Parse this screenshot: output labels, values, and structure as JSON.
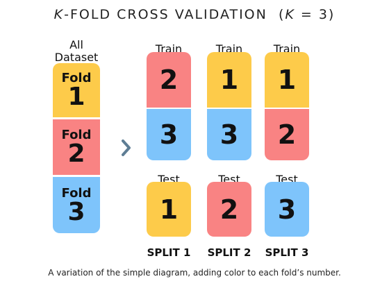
{
  "title": {
    "k_italic": "K",
    "main": "-FOLD CROSS VALIDATION",
    "paren": "(K = 3)"
  },
  "dataset": {
    "header_line1": "All",
    "header_line2": "Dataset",
    "folds": [
      {
        "word": "Fold",
        "number": "1",
        "color": "#FDCB4A"
      },
      {
        "word": "Fold",
        "number": "2",
        "color": "#F98383"
      },
      {
        "word": "Fold",
        "number": "3",
        "color": "#7EC4FB"
      }
    ]
  },
  "arrow_icon": "chevron-right",
  "splits": [
    {
      "label": "SPLIT 1",
      "train_header": "Train",
      "test_header": "Test",
      "train": [
        {
          "number": "2",
          "color": "#F98383"
        },
        {
          "number": "3",
          "color": "#7EC4FB"
        }
      ],
      "test": {
        "number": "1",
        "color": "#FDCB4A"
      }
    },
    {
      "label": "SPLIT 2",
      "train_header": "Train",
      "test_header": "Test",
      "train": [
        {
          "number": "1",
          "color": "#FDCB4A"
        },
        {
          "number": "3",
          "color": "#7EC4FB"
        }
      ],
      "test": {
        "number": "2",
        "color": "#F98383"
      }
    },
    {
      "label": "SPLIT 3",
      "train_header": "Train",
      "test_header": "Test",
      "train": [
        {
          "number": "1",
          "color": "#FDCB4A"
        },
        {
          "number": "2",
          "color": "#F98383"
        }
      ],
      "test": {
        "number": "3",
        "color": "#7EC4FB"
      }
    }
  ],
  "caption": "A variation of the simple diagram, adding color to each fold’s number.",
  "colors": {
    "yellow": "#FDCB4A",
    "red": "#F98383",
    "blue": "#7EC4FB",
    "arrow": "#5E7D94"
  }
}
